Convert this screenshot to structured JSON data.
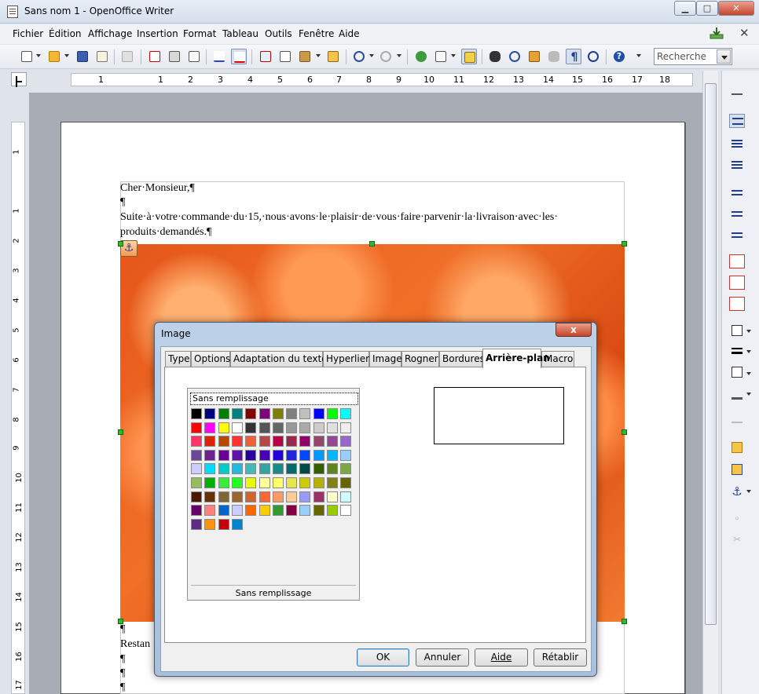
{
  "window": {
    "title": "Sans nom 1 - OpenOffice Writer"
  },
  "menu": [
    {
      "label": "Fichier"
    },
    {
      "label": "Édition"
    },
    {
      "label": "Affichage"
    },
    {
      "label": "Insertion"
    },
    {
      "label": "Format"
    },
    {
      "label": "Tableau"
    },
    {
      "label": "Outils"
    },
    {
      "label": "Fenêtre"
    },
    {
      "label": "Aide"
    }
  ],
  "toolbar": {
    "search_placeholder": "Recherche"
  },
  "ruler": {
    "h_marks": [
      "1",
      "1",
      "2",
      "3",
      "4",
      "5",
      "6",
      "7",
      "8",
      "9",
      "10",
      "11",
      "12",
      "13",
      "14",
      "15",
      "16",
      "17",
      "18"
    ],
    "v_marks": [
      "1",
      "1",
      "2",
      "3",
      "4",
      "5",
      "6",
      "7",
      "8",
      "9",
      "10",
      "11",
      "12",
      "13",
      "14",
      "15",
      "16",
      "17"
    ]
  },
  "document": {
    "line1": "Cher·Monsieur,¶",
    "line2": "¶",
    "line3": "Suite·à·votre·commande·du·15,·nous·avons·le·plaisir·de·vous·faire·parvenir·la·livraison·avec·les·",
    "line4": "produits·demandés.¶",
    "after_image": [
      "¶",
      "Restan",
      "¶",
      "¶",
      "¶"
    ]
  },
  "dialog": {
    "title": "Image",
    "close": "x",
    "tabs": [
      "Type",
      "Options",
      "Adaptation du texte",
      "Hyperlien",
      "Image",
      "Rogner",
      "Bordures",
      "Arrière-plan",
      "Macro"
    ],
    "active_tab": "Arrière-plan",
    "nofill_label": "Sans remplissage",
    "nofill_caption": "Sans remplissage",
    "buttons": {
      "ok": "OK",
      "cancel": "Annuler",
      "help": "Aide",
      "reset": "Rétablir"
    }
  },
  "palette": [
    [
      "#000000",
      "#000080",
      "#008000",
      "#008080",
      "#800000",
      "#800080",
      "#808000",
      "#808080",
      "#c0c0c0",
      "#0000ff",
      "#00ff00",
      "#00ffff"
    ],
    [
      "#ff0000",
      "#ff00ff",
      "#ffff00",
      "#ffffff",
      "#333333",
      "#555555",
      "#666666",
      "#999999",
      "#aaaaaa",
      "#cccccc",
      "#e0e0e0",
      "#eeeeee"
    ],
    [
      "#ff3366",
      "#dc2300",
      "#b84700",
      "#ff3333",
      "#eb613d",
      "#b84747",
      "#b80047",
      "#99284c",
      "#94006b",
      "#94476b",
      "#944794",
      "#9966cc"
    ],
    [
      "#6b4794",
      "#6b2394",
      "#6b0094",
      "#5e11a6",
      "#280099",
      "#4700b8",
      "#2300dc",
      "#2323dc",
      "#0047ff",
      "#0099ff",
      "#00b8ff",
      "#99ccff"
    ],
    [
      "#ccccff",
      "#00dcff",
      "#00cccc",
      "#23b8dc",
      "#47b8b8",
      "#33a3a3",
      "#198a8a",
      "#006b6b",
      "#004a4a",
      "#355e00",
      "#5c8526",
      "#7da647"
    ],
    [
      "#94bd5e",
      "#00ae00",
      "#3deb3d",
      "#23ff23",
      "#e6ff00",
      "#ffff99",
      "#ffff66",
      "#e6e64c",
      "#cccc00",
      "#b3b300",
      "#808019",
      "#666600"
    ],
    [
      "#4c1900",
      "#663300",
      "#806633",
      "#996633",
      "#cc6633",
      "#ff6633",
      "#ff9966",
      "#ffcc99",
      "#9999ff",
      "#993366",
      "#ffffcc",
      "#ccffff"
    ],
    [
      "#660066",
      "#ff8080",
      "#0066cc",
      "#ccccff",
      "#ff6600",
      "#ffcc00",
      "#339933",
      "#800040",
      "#99ccff",
      "#666600",
      "#99cc00",
      "#ffffff"
    ],
    [
      "#5e2a84",
      "#ff950e",
      "#c5000b",
      "#0084d1"
    ]
  ],
  "colors": {
    "handle": "#2dbb2d",
    "dialog_frame": "#bcd0e8"
  }
}
